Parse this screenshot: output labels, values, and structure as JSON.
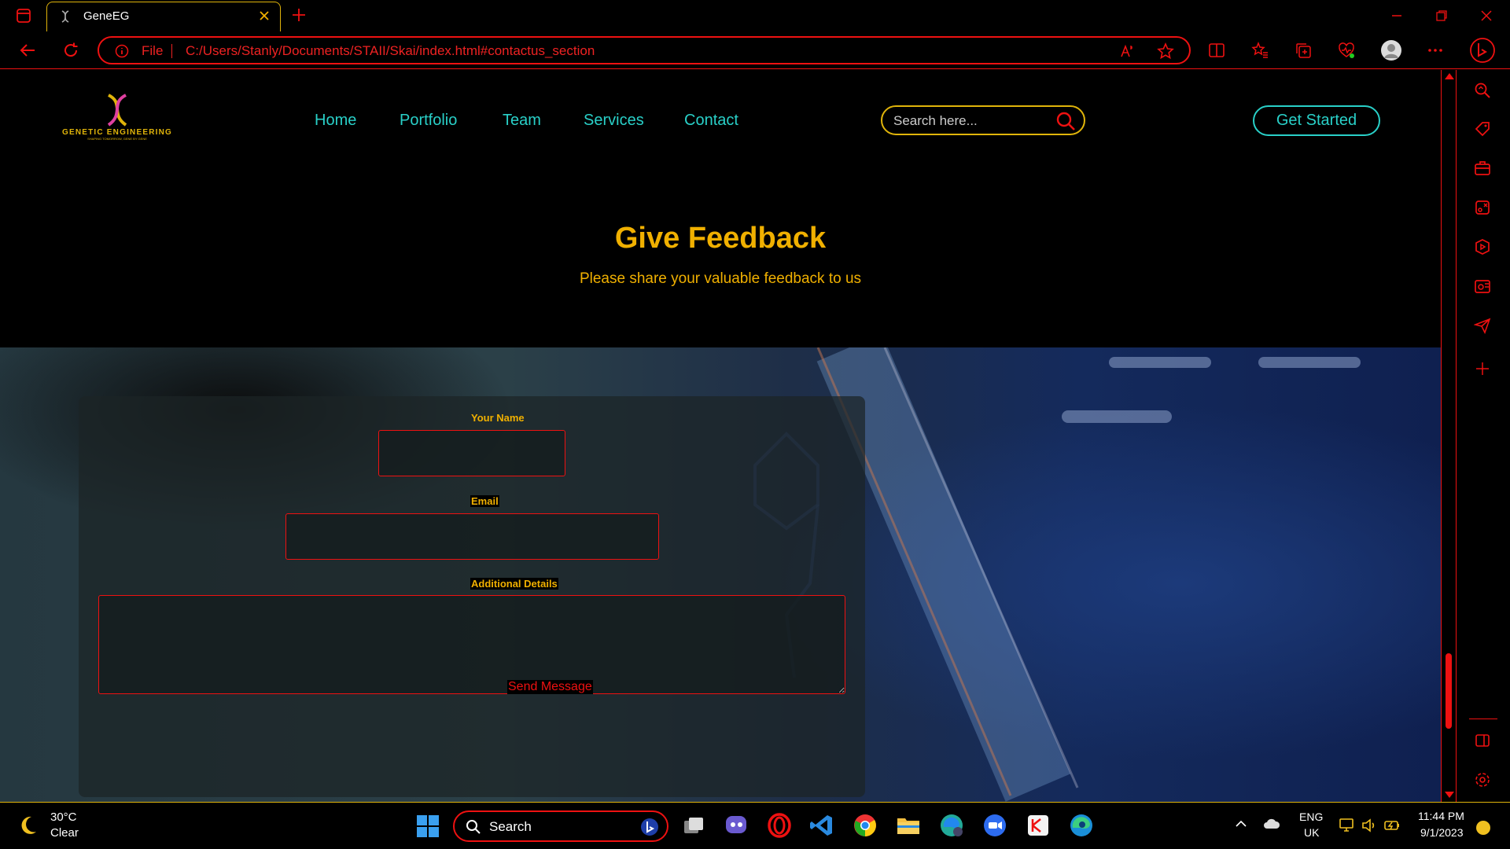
{
  "browser": {
    "tab_title": "GeneEG",
    "file_label": "File",
    "url": "C:/Users/Stanly/Documents/STAII/Skai/index.html#contactus_section"
  },
  "site": {
    "logo_title": "GENETIC ENGINEERING",
    "logo_tagline": "SHAPING TOMORROW, GENE BY GENE",
    "nav": [
      "Home",
      "Portfolio",
      "Team",
      "Services",
      "Contact"
    ],
    "search_placeholder": "Search here...",
    "cta_label": "Get Started",
    "heading": "Give Feedback",
    "subheading": "Please share your valuable feedback to us"
  },
  "form": {
    "name_label": "Your Name",
    "email_label": "Email",
    "details_label": "Additional Details",
    "submit_label": "Send Message"
  },
  "taskbar": {
    "weather_temp": "30°C",
    "weather_condition": "Clear",
    "search_label": "Search",
    "lang_line1": "ENG",
    "lang_line2": "UK",
    "time": "11:44 PM",
    "date": "9/1/2023"
  },
  "colors": {
    "accent_gold": "#f0b000",
    "accent_teal": "#29d0c8",
    "accent_red": "#e11"
  }
}
